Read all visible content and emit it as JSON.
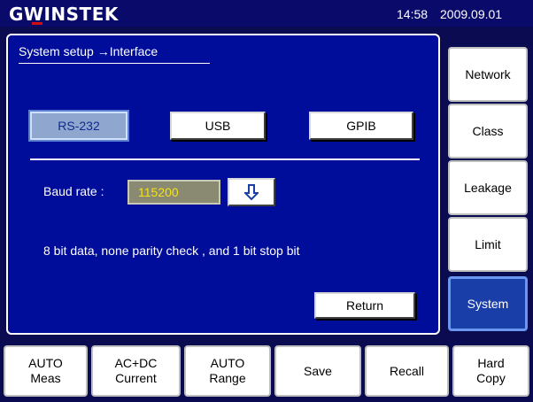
{
  "header": {
    "brand": "GWINSTEK",
    "time": "14:58",
    "date": "2009.09.01"
  },
  "main": {
    "breadcrumb": "System setup →Interface",
    "tabs": [
      {
        "label": "RS-232",
        "selected": true
      },
      {
        "label": "USB",
        "selected": false
      },
      {
        "label": "GPIB",
        "selected": false
      }
    ],
    "baud": {
      "label": "Baud rate :",
      "value": "115200"
    },
    "info": "8 bit data, none parity check , and 1 bit stop bit",
    "return_label": "Return"
  },
  "sidebar": {
    "items": [
      {
        "label": "Network",
        "selected": false
      },
      {
        "label": "Class",
        "selected": false
      },
      {
        "label": "Leakage",
        "selected": false
      },
      {
        "label": "Limit",
        "selected": false
      },
      {
        "label": "System",
        "selected": true
      }
    ]
  },
  "bottom": {
    "buttons": [
      {
        "label": "AUTO\nMeas"
      },
      {
        "label": "AC+DC\nCurrent"
      },
      {
        "label": "AUTO\nRange"
      },
      {
        "label": "Save"
      },
      {
        "label": "Recall"
      },
      {
        "label": "Hard\nCopy"
      }
    ]
  },
  "colors": {
    "panel_bg": "#000c9a",
    "selected_tab": "#8fa7cf",
    "baud_text": "#f2e21a",
    "system_selected": "#1a3ea8"
  },
  "icons": {
    "dropdown": "down-arrow-icon"
  }
}
